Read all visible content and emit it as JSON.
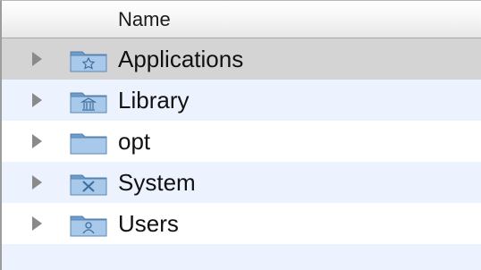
{
  "header": {
    "column_name": "Name"
  },
  "rows": [
    {
      "label": "Applications",
      "icon": "applications-folder-icon",
      "selected": true
    },
    {
      "label": "Library",
      "icon": "library-folder-icon",
      "selected": false
    },
    {
      "label": "opt",
      "icon": "folder-icon",
      "selected": false
    },
    {
      "label": "System",
      "icon": "system-folder-icon",
      "selected": false
    },
    {
      "label": "Users",
      "icon": "users-folder-icon",
      "selected": false
    }
  ],
  "colors": {
    "selected_row": "#d4d4d4",
    "stripe_row": "#edf3fe",
    "folder_blue": "#8fb6de"
  }
}
